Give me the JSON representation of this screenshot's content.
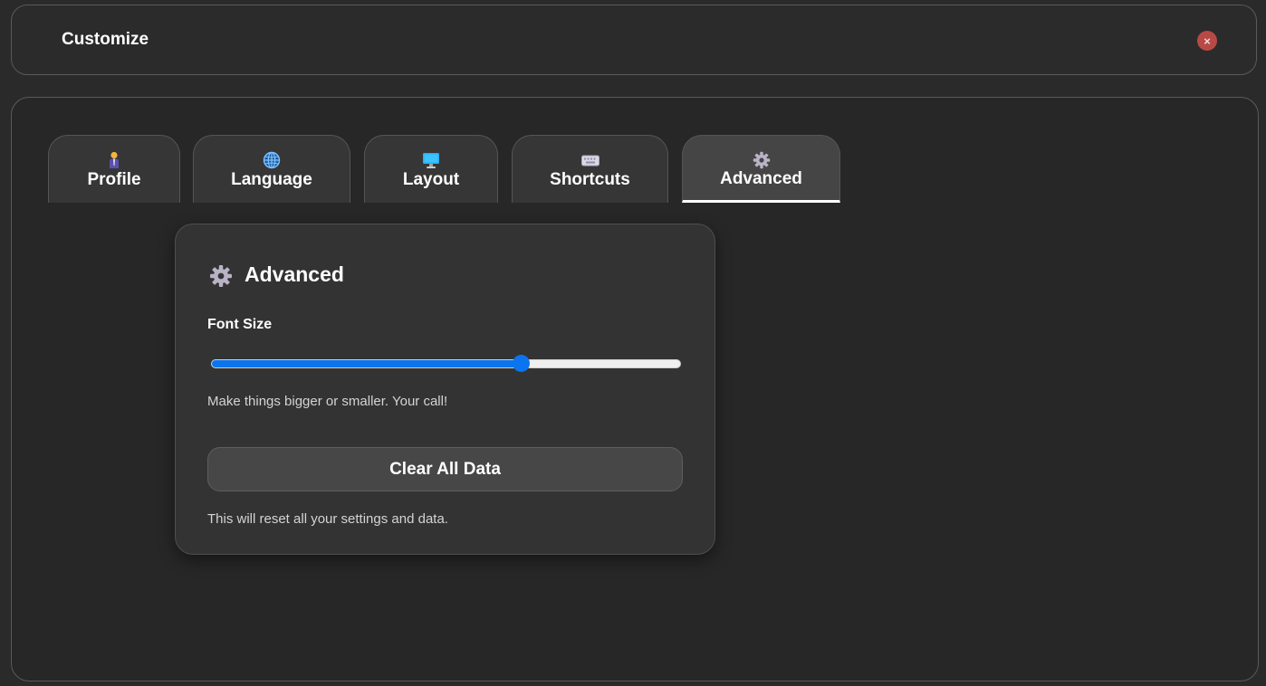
{
  "header": {
    "title": "Customize",
    "close_symbol": "×",
    "close_color": "#b84a45"
  },
  "tabs": [
    {
      "label": "Profile",
      "icon": "person-icon",
      "active": false
    },
    {
      "label": "Language",
      "icon": "globe-icon",
      "active": false
    },
    {
      "label": "Layout",
      "icon": "monitor-icon",
      "active": false
    },
    {
      "label": "Shortcuts",
      "icon": "keyboard-icon",
      "active": false
    },
    {
      "label": "Advanced",
      "icon": "gear-icon",
      "active": true
    }
  ],
  "advanced": {
    "title": "Advanced",
    "icon": "gear-icon",
    "font_size": {
      "label": "Font Size",
      "value_fraction": 0.66,
      "help": "Make things bigger or smaller. Your call!"
    },
    "clear_button": "Clear All Data",
    "clear_note": "This will reset all your settings and data."
  },
  "colors": {
    "accent": "#0a75ee",
    "background": "#272727",
    "card": "#333333"
  }
}
